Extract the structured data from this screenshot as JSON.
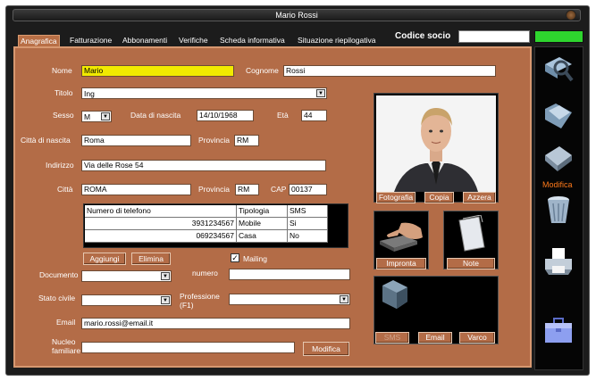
{
  "window": {
    "title": "Mario Rossi"
  },
  "tabs": [
    {
      "label": "Anagrafica"
    },
    {
      "label": "Fatturazione"
    },
    {
      "label": "Abbonamenti"
    },
    {
      "label": "Verifiche"
    },
    {
      "label": "Scheda informativa"
    },
    {
      "label": "Situazione riepilogativa"
    }
  ],
  "codice_socio": {
    "label": "Codice socio",
    "value": ""
  },
  "form": {
    "nome": {
      "label": "Nome",
      "value": "Mario"
    },
    "cognome": {
      "label": "Cognome",
      "value": "Rossi"
    },
    "titolo": {
      "label": "Titolo",
      "value": "Ing"
    },
    "sesso": {
      "label": "Sesso",
      "value": "M"
    },
    "data_nascita": {
      "label": "Data di nascita",
      "value": "14/10/1968"
    },
    "eta": {
      "label": "Età",
      "value": "44"
    },
    "citta_nascita": {
      "label": "Città di nascita",
      "value": "Roma"
    },
    "provincia_nascita": {
      "label": "Provincia",
      "value": "RM"
    },
    "indirizzo": {
      "label": "Indirizzo",
      "value": "Via delle Rose 54"
    },
    "citta": {
      "label": "Città",
      "value": "ROMA"
    },
    "provincia": {
      "label": "Provincia",
      "value": "RM"
    },
    "cap": {
      "label": "CAP",
      "value": "00137"
    },
    "documento": {
      "label": "Documento",
      "value": ""
    },
    "numero": {
      "label": "numero",
      "value": ""
    },
    "stato_civile": {
      "label": "Stato civile",
      "value": ""
    },
    "professione": {
      "label": "Professione (F1)",
      "value": ""
    },
    "email": {
      "label": "Email",
      "value": "mario.rossi@email.it"
    },
    "nucleo": {
      "label": "Nucleo familiare",
      "value": ""
    },
    "mailing": {
      "label": "Mailing",
      "checked": true
    }
  },
  "phones": {
    "headers": [
      "Numero di telefono",
      "Tipologia",
      "SMS"
    ],
    "rows": [
      [
        "3931234567",
        "Mobile",
        "Si"
      ],
      [
        "069234567",
        "Casa",
        "No"
      ]
    ]
  },
  "buttons": {
    "aggiungi": "Aggiungi",
    "elimina": "Elimina",
    "fotografia": "Fotografia",
    "copia": "Copia",
    "azzera": "Azzera",
    "impronta": "Impronta",
    "note": "Note",
    "sms": "SMS",
    "email": "Email",
    "varco": "Varco",
    "modifica_nucleo": "Modifica"
  },
  "sidebar": {
    "items": [
      {
        "icon": "search-icon"
      },
      {
        "icon": "folder-icon"
      },
      {
        "icon": "floppy-disk-icon",
        "label": "Modifica"
      },
      {
        "icon": "trash-icon"
      },
      {
        "icon": "printer-icon"
      },
      {
        "icon": "briefcase-icon"
      }
    ]
  },
  "colors": {
    "panel": "#b36c47",
    "accent_green": "#2ed52e",
    "name_highlight": "#f1ea00",
    "modifica_label": "#ff7a1a"
  }
}
